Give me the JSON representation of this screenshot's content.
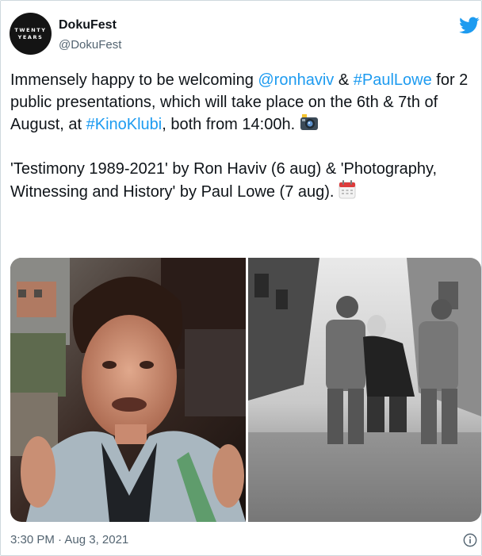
{
  "tweet": {
    "avatar_text_line1": "TWENTY",
    "avatar_text_line2": "YEARS",
    "author_name": "DokuFest",
    "author_handle": "@DokuFest",
    "p1_t1": "Immensely happy to be welcoming ",
    "p1_link1": "@ronhaviv",
    "p1_t2": " & ",
    "p1_link2": "#PaulLowe",
    "p1_t3": " for 2 public presentations, which will take place on the 6th & 7th of August, at ",
    "p1_link3": "#KinoKlubi",
    "p1_t4": ", both from 14:00h. ",
    "p2_text": "'Testimony 1989-2021' by Ron Haviv (6 aug) & 'Photography, Witnessing and History' by Paul Lowe (7 aug). ",
    "timestamp": "3:30 PM · Aug 3, 2021"
  },
  "icons": {
    "brand": "twitter-bird-icon",
    "emoji1": "camera-with-flash-icon",
    "emoji2": "calendar-icon",
    "footer": "info-icon"
  },
  "colors": {
    "link": "#1d9bf0",
    "twitter_blue": "#1d9bf0",
    "muted": "#536471",
    "text": "#0f1419"
  },
  "media": {
    "photo1": "color photo of a distressed man in a jacket, hands raised",
    "photo2": "black and white photo of two helmeted soldiers escorting a man on a misty street"
  }
}
